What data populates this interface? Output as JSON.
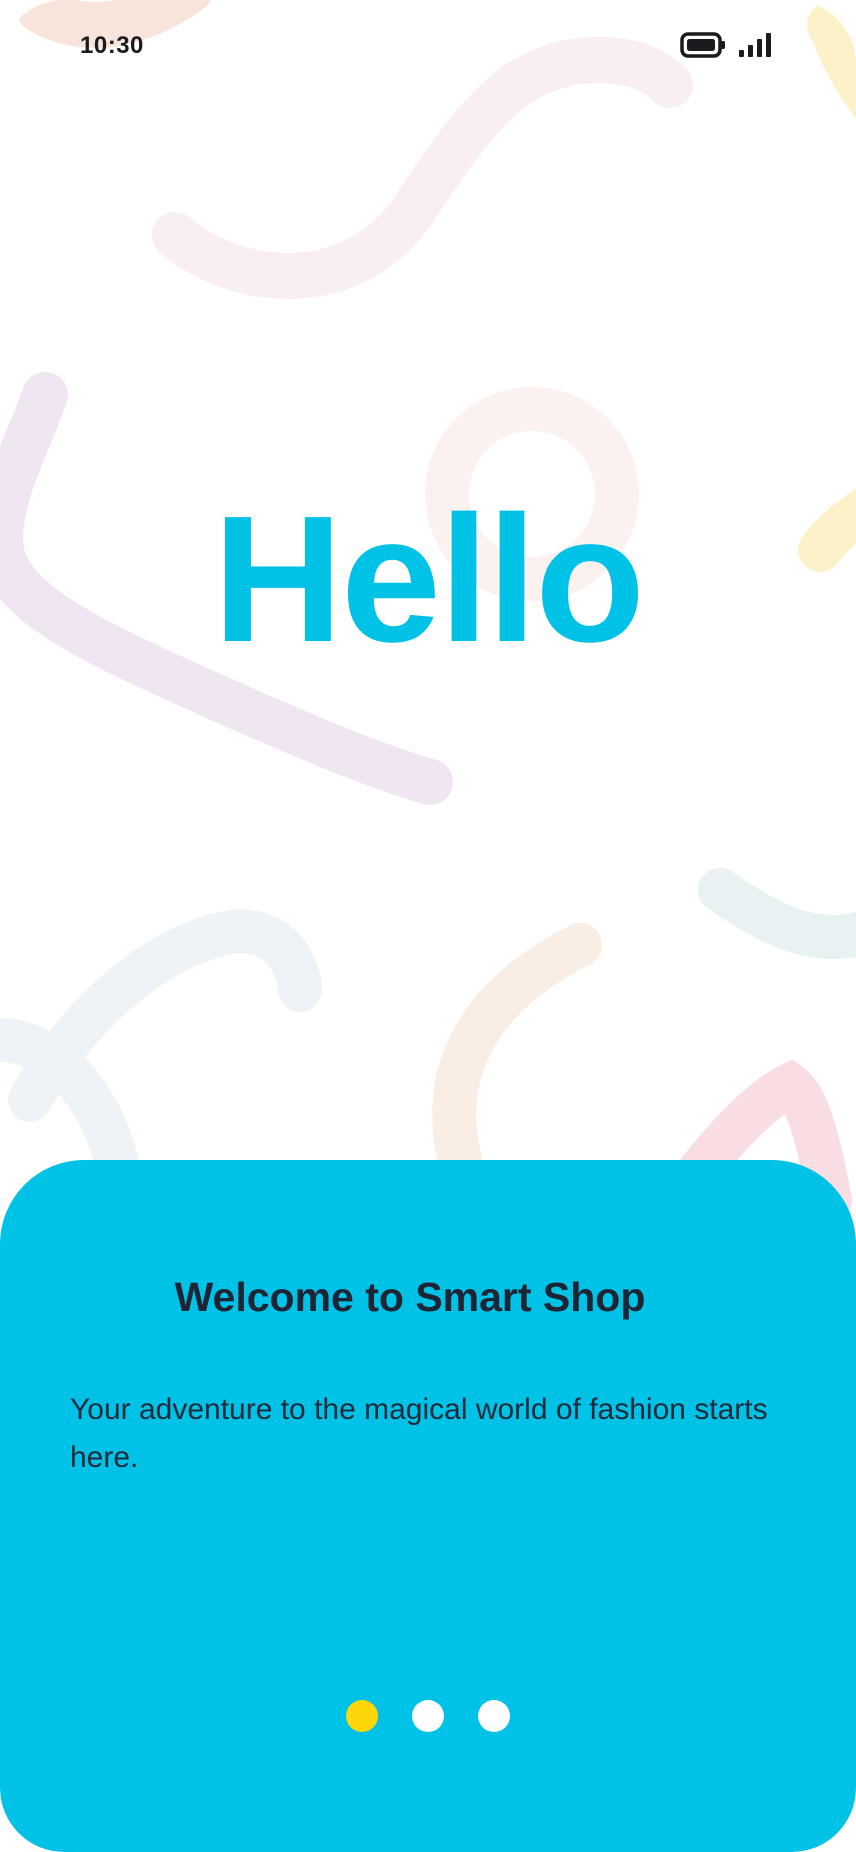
{
  "status_bar": {
    "time": "10:30"
  },
  "hero": {
    "title": "Hello"
  },
  "onboarding": {
    "title": "Welcome to Smart Shop",
    "body": "Your adventure to the magical world of fashion starts here.",
    "page_count": 3,
    "current_page": 1
  },
  "colors": {
    "accent": "#00c1e6",
    "active_dot": "#ffd60a",
    "inactive_dot": "#ffffff",
    "title_text": "#1d2433"
  }
}
